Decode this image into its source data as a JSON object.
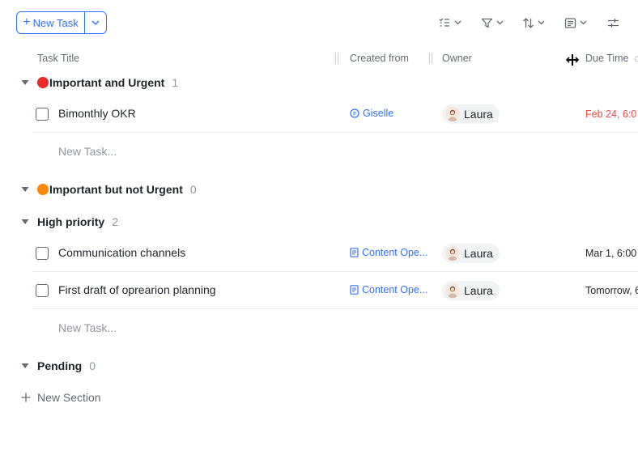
{
  "toolbar": {
    "new_task_label": "New Task",
    "plus_symbol": "+",
    "icons": [
      "checklist-icon",
      "filter-icon",
      "sort-icon",
      "group-icon",
      "settings-sliders-icon"
    ]
  },
  "columns": {
    "task_title": "Task Title",
    "created_from": "Created from",
    "owner": "Owner",
    "due_time": "Due Time"
  },
  "sections": [
    {
      "name": "Important and Urgent",
      "count": "1",
      "color": "#e82a2a",
      "tasks": [
        {
          "title": "Bimonthly OKR",
          "created_from": "Giselle",
          "source_icon": "chat-icon",
          "owner": "Laura",
          "due": "Feb 24, 6:0",
          "due_color": "#f54a45"
        }
      ],
      "new_task_placeholder": "New Task..."
    },
    {
      "name": "Important but not Urgent",
      "count": "0",
      "color": "#ff8800",
      "tasks": []
    },
    {
      "name": "High priority",
      "count": "2",
      "tasks": [
        {
          "title": "Communication channels",
          "created_from": "Content Ope...",
          "source_icon": "doc-icon",
          "owner": "Laura",
          "due": "Mar 1, 6:00",
          "due_color": "#1f2329"
        },
        {
          "title": "First draft of oprearion planning",
          "created_from": "Content Ope...",
          "source_icon": "doc-icon",
          "owner": "Laura",
          "due": "Tomorrow, 6",
          "due_color": "#1f2329"
        }
      ],
      "new_task_placeholder": "New Task..."
    },
    {
      "name": "Pending",
      "count": "0",
      "tasks": []
    }
  ],
  "new_section_label": "New Section"
}
